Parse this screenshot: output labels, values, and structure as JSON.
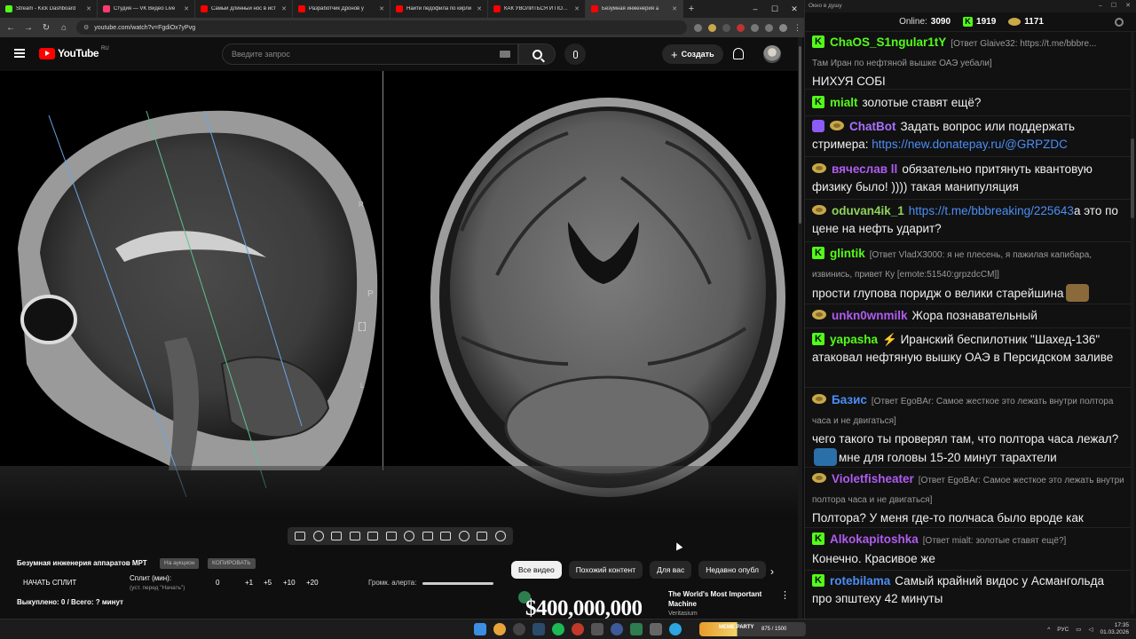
{
  "browser": {
    "tabs": [
      {
        "label": "Stream - Kick Dashboard",
        "color": "#53fc18"
      },
      {
        "label": "Студия — VK Видео Live",
        "color": "#ff3b6b"
      },
      {
        "label": "Самый длинный нос в ист",
        "color": "#ff0000"
      },
      {
        "label": "Разработчик Дронов у",
        "color": "#ff0000"
      },
      {
        "label": "Найти педофила по кирли",
        "color": "#ff0000"
      },
      {
        "label": "КАК УВОЛИТЬСЯ И ПОЛУЧ",
        "color": "#ff0000"
      },
      {
        "label": "Безумная инженерия а",
        "color": "#ff0000",
        "active": true
      }
    ],
    "url": "youtube.com/watch?v=FgdiOx7yPvg"
  },
  "youtube": {
    "logo_text": "YouTube",
    "region": "RU",
    "search_placeholder": "Введите запрос",
    "create_label": "Создать"
  },
  "video": {
    "scale_labels": [
      "R",
      "P",
      "L"
    ]
  },
  "controls": {
    "video_title": "Безумная инженерия аппаратов МРТ",
    "pill_1": "На аукцион",
    "pill_2": "КОПИРОВАТЬ",
    "start_split": "НАЧАТЬ СПЛИТ",
    "split_label": "Сплит (мин):",
    "split_hint": "(уст. перед \"Начать\")",
    "split_values": [
      "0",
      "+1",
      "+5",
      "+10",
      "+20"
    ],
    "alert_volume_label": "Громк. алерта:",
    "status": "Выкуплено: 0 / Всего: ? минут"
  },
  "chips": [
    "Все видео",
    "Похожий контент",
    "Для вас",
    "Недавно опубл"
  ],
  "recommendation": {
    "thumb_text": "$400,000,000",
    "title": "The World's Most Important Machine",
    "channel": "Veritasium"
  },
  "chat": {
    "window_title": "Окно в душу",
    "online_label": "Online:",
    "online_count": "3090",
    "kick_count": "1919",
    "coin_count": "1171",
    "messages": [
      {
        "badge": "k",
        "user": "ChaOS_S1ngular1tY",
        "color": "#53fc18",
        "reply": "[Ответ Glaive32: https://t.me/bbbre...",
        "reply2": "Там Иран по нефтяной вышке ОАЭ уебали]",
        "text": "НИХУЯ СОБІ"
      },
      {
        "badge": "k",
        "user": "mialt",
        "color": "#53fc18",
        "text": "золотые ставят ещё?"
      },
      {
        "badge": "bot",
        "user": "ChatBot",
        "color": "#a970ff",
        "text": "Задать вопрос или поддержать стримера: ",
        "link": "https://new.donatepay.ru/@GRPZDC"
      },
      {
        "badge": "coin",
        "user": "вячеслав ll",
        "color": "#b05cf0",
        "text": "обязательно притянуть квантовую физику было! )))) такая манипуляция"
      },
      {
        "badge": "coin",
        "user": "oduvan4ik_1",
        "color": "#53fc18",
        "link": "https://t.me/bbbreaking/225643",
        "text": "а это по цене на нефть ударит?"
      },
      {
        "badge": "k",
        "user": "glintik",
        "color": "#53fc18",
        "reply": "[Ответ VladX3000: я не плесень, я пажилая капибара, извинись, привет Ку [emote:51540:grpzdcCM]]",
        "text": "прости глупова поридж о велики старейшина"
      },
      {
        "badge": "coin",
        "user": "unkn0wnmilk",
        "color": "#b05cf0",
        "text": "Жора познавательный"
      },
      {
        "badge": "k",
        "user": "yapasha",
        "color": "#53fc18",
        "text": "⚡ Иранский беспилотник \"Шахед-136\" атаковал нефтяную вышку ОАЭ в Персидском заливе"
      },
      {
        "badge": "coin",
        "user": "Базис",
        "color": "#4b8ef5",
        "reply": "[Ответ EgoBAr: Самое жесткое это лежать внутри полтора часа и не двигаться]",
        "text": "чего такого ты проверял там, что полтора часа лежал?",
        "text2": "мне для головы 15-20 минут тарахтели"
      },
      {
        "badge": "coin",
        "user": "Violetfisheater",
        "color": "#b05cf0",
        "reply": "[Ответ EgoBAr: Самое жесткое это лежать внутри полтора часа и не двигаться]",
        "text": "Полтора? У меня где-то полчаса было вроде как"
      },
      {
        "badge": "k",
        "user": "Alkokapitoshka",
        "color": "#b05cf0",
        "reply": "[Ответ mialt: золотые ставят ещё?]",
        "text": "Конечно. Красивое же"
      },
      {
        "badge": "k",
        "user": "rotebilama",
        "color": "#4b8ef5",
        "text": "Самый крайний видос у Асмангольда про эпштеху 42 минуты"
      }
    ]
  },
  "taskbar": {
    "widget_label": "MEME PARTY",
    "widget_value": "875 / 1500",
    "lang": "РУС",
    "time": "17:35",
    "date": "01.03.2026"
  }
}
